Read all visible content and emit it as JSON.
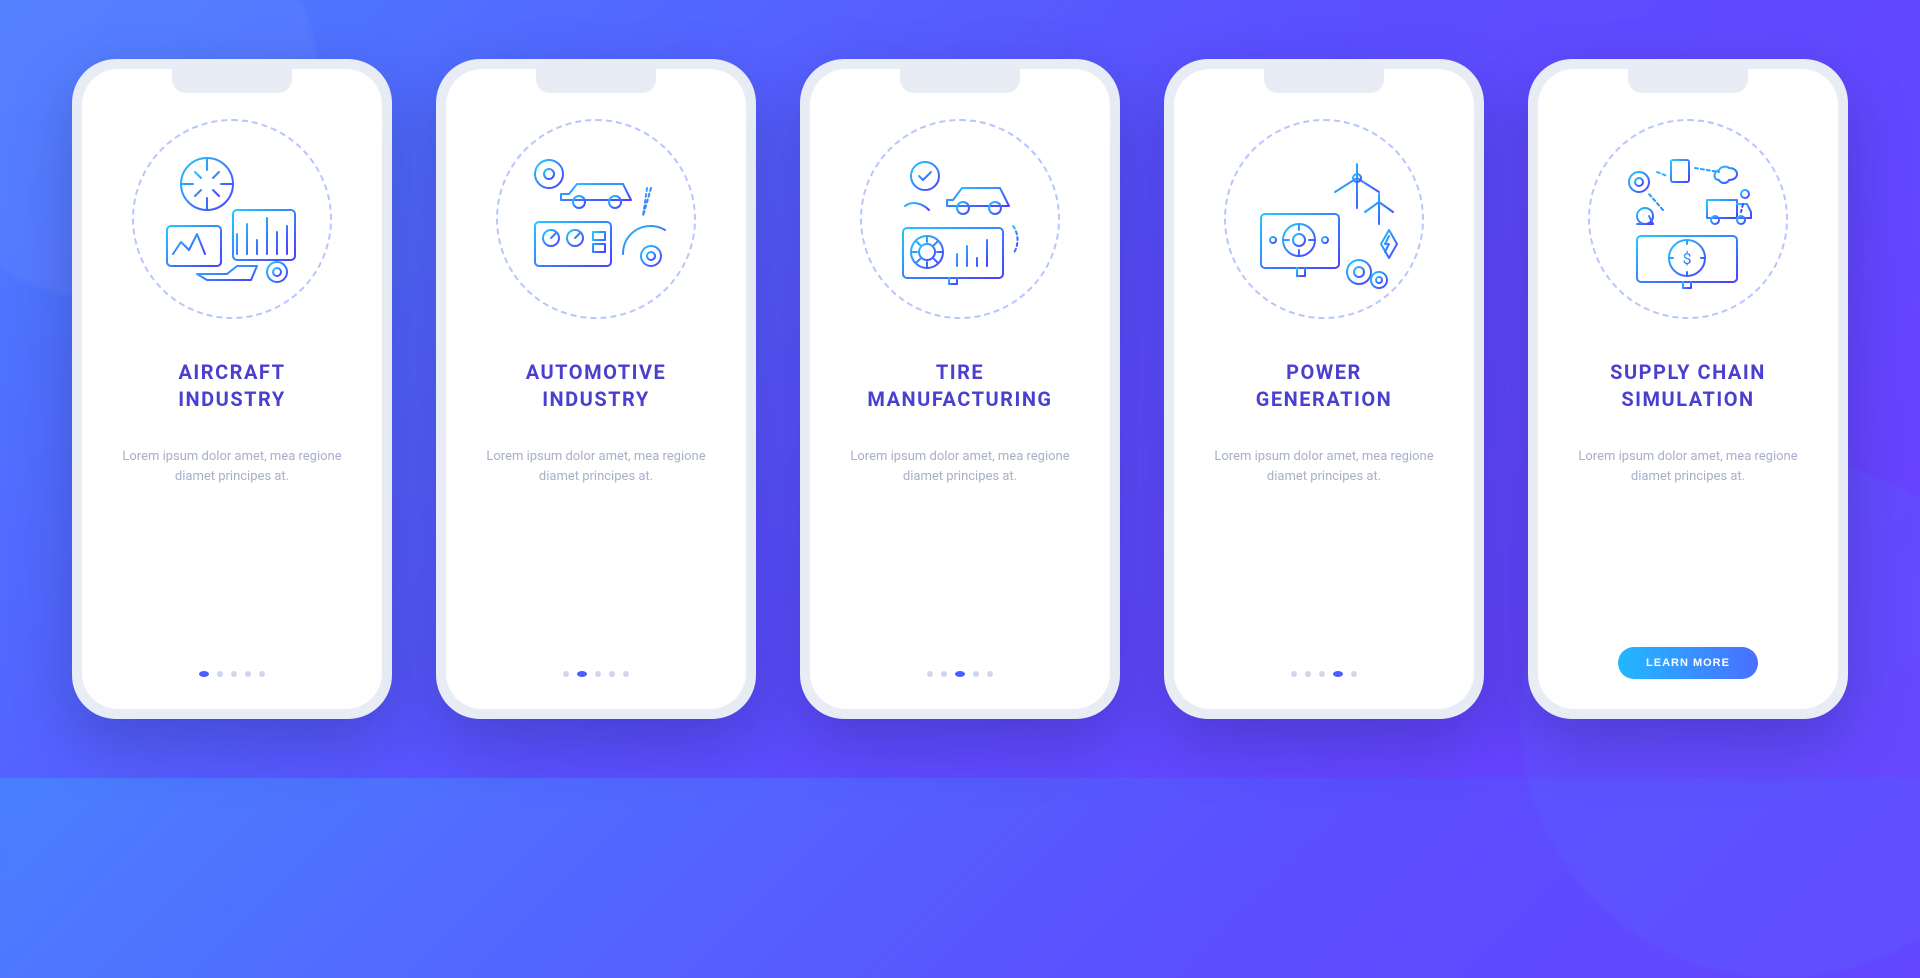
{
  "common": {
    "description": "Lorem ipsum dolor amet, mea regione diamet principes at.",
    "button_label": "LEARN MORE",
    "total_steps": 5
  },
  "screens": [
    {
      "title_line1": "AIRCRAFT",
      "title_line2": "INDUSTRY",
      "icon": "aircraft-industry-icon",
      "active_step": 1
    },
    {
      "title_line1": "AUTOMOTIVE",
      "title_line2": "INDUSTRY",
      "icon": "automotive-industry-icon",
      "active_step": 2
    },
    {
      "title_line1": "TIRE",
      "title_line2": "MANUFACTURING",
      "icon": "tire-manufacturing-icon",
      "active_step": 3
    },
    {
      "title_line1": "POWER",
      "title_line2": "GENERATION",
      "icon": "power-generation-icon",
      "active_step": 4
    },
    {
      "title_line1": "SUPPLY CHAIN",
      "title_line2": "SIMULATION",
      "icon": "supply-chain-icon",
      "active_step": 5
    }
  ]
}
